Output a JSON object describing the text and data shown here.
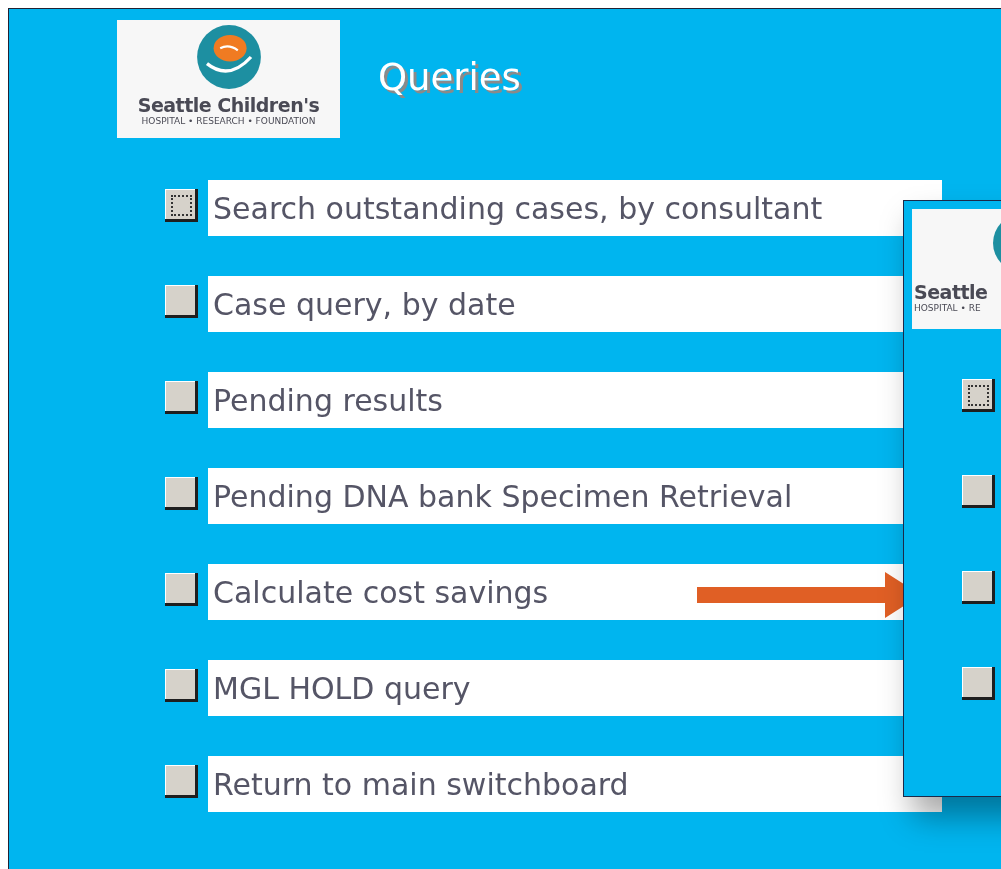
{
  "header": {
    "logo": {
      "name": "Seattle Children's",
      "tagline": "HOSPITAL • RESEARCH • FOUNDATION"
    },
    "title": "Queries"
  },
  "items": [
    {
      "label": "Search outstanding cases, by consultant",
      "focused": true
    },
    {
      "label": "Case query, by date",
      "focused": false
    },
    {
      "label": "Pending results",
      "focused": false
    },
    {
      "label": "Pending DNA bank Specimen Retrieval",
      "focused": false
    },
    {
      "label": "Calculate cost savings",
      "focused": false
    },
    {
      "label": "MGL HOLD query",
      "focused": false
    },
    {
      "label": "Return to main switchboard",
      "focused": false
    }
  ],
  "overlay_window": {
    "logo": {
      "name": "Seattle",
      "tagline": "HOSPITAL • RE"
    },
    "buttons": [
      {
        "focused": true
      },
      {
        "focused": false
      },
      {
        "focused": false
      },
      {
        "focused": false
      }
    ]
  }
}
